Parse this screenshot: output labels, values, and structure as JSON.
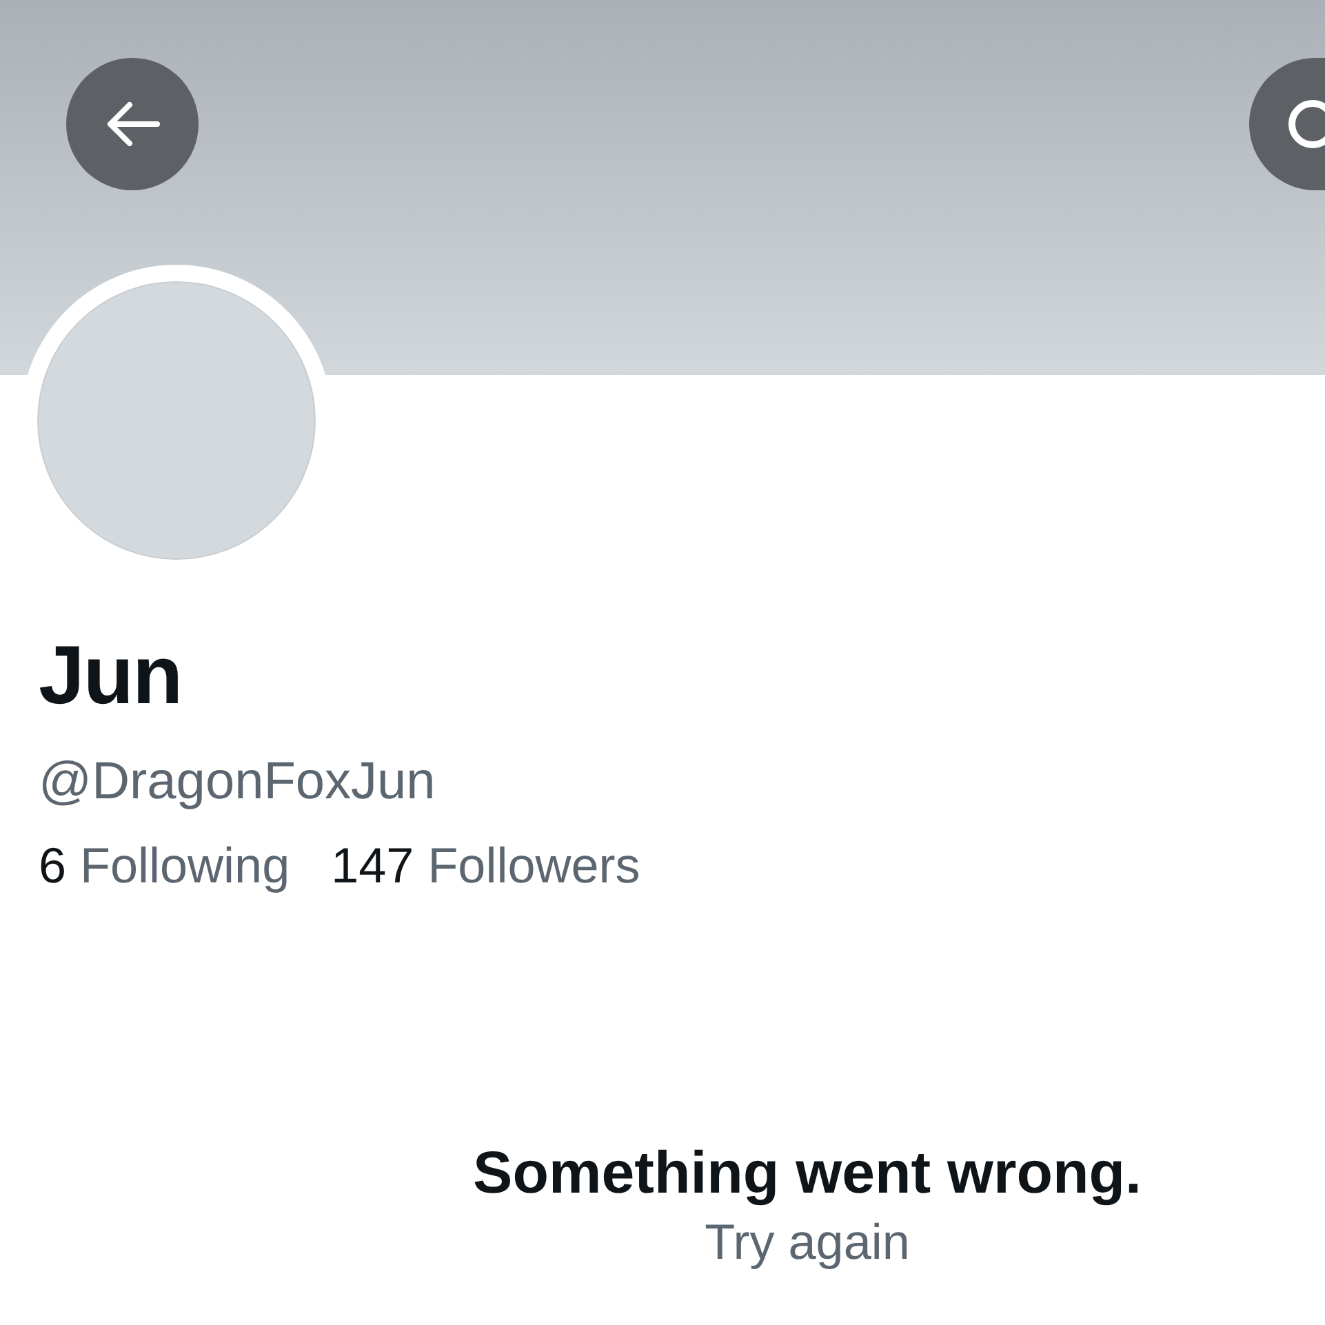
{
  "profile": {
    "name": "Jun",
    "handle": "@DragonFoxJun",
    "stats": [
      {
        "count": "6",
        "label": "Following"
      },
      {
        "count": "147",
        "label": "Followers"
      }
    ]
  },
  "error": {
    "title": "Something went wrong.",
    "action": "Try again"
  }
}
